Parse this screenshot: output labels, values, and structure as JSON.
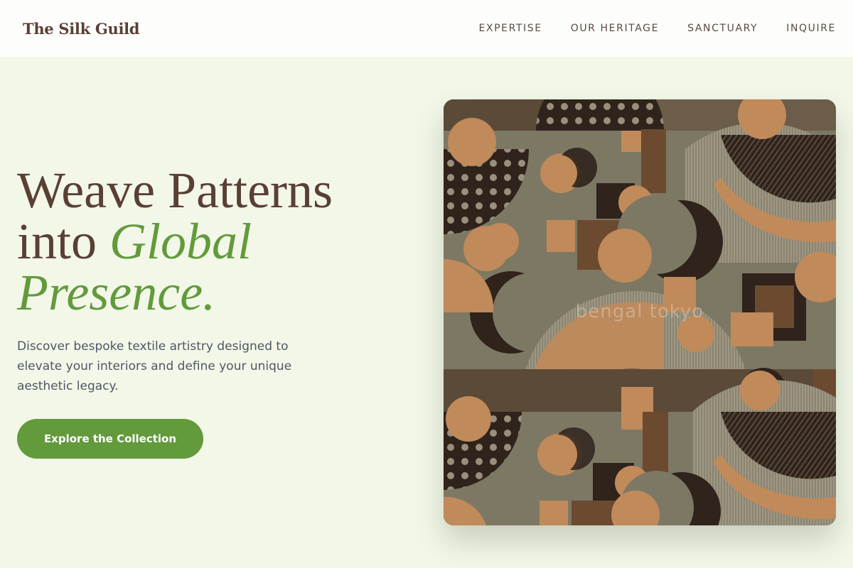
{
  "header": {
    "brand": "The Silk Guild",
    "nav": [
      "EXPERTISE",
      "OUR HERITAGE",
      "SANCTUARY",
      "INQUIRE"
    ]
  },
  "hero": {
    "headline_line1": "Weave Patterns",
    "headline_line2_plain": "into ",
    "headline_line2_accent": "Global",
    "headline_line3_accent": "Presence.",
    "subtitle": "Discover bespoke textile artistry designed to elevate your interiors and define your unique aesthetic legacy.",
    "cta_label": "Explore the Collection"
  },
  "artwork": {
    "watermark": "bengal tokyo",
    "palette": {
      "base": "#7d7864",
      "dark": "#2f231c",
      "tan": "#c08a5a",
      "brown": "#6b4a30",
      "dot": "#9a8f7c"
    }
  },
  "colors": {
    "background": "#f2f7e8",
    "header": "#fdfefb",
    "brand_text": "#5a3f35",
    "accent": "#629a3c",
    "body_text": "#4f5763"
  }
}
